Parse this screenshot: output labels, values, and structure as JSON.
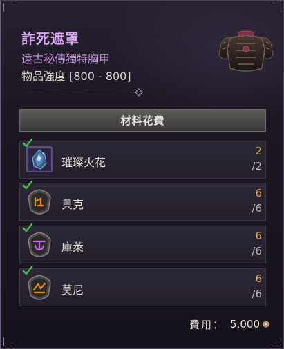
{
  "item": {
    "name": "詐死遮罩",
    "type": "遠古秘傳獨特胸甲",
    "power": "物品強度 [800 - 800]",
    "icon": "chest-armor-icon"
  },
  "materials": {
    "header": "材料花費",
    "rows": [
      {
        "name": "璀璨火花",
        "have": "2",
        "need": "/2",
        "icon": "resplendent-spark-icon",
        "checked": true
      },
      {
        "name": "貝克",
        "have": "6",
        "need": "/6",
        "icon": "ber-rune-icon",
        "checked": true
      },
      {
        "name": "庫萊",
        "have": "6",
        "need": "/6",
        "icon": "cir-rune-icon",
        "checked": true
      },
      {
        "name": "莫尼",
        "have": "6",
        "need": "/6",
        "icon": "mon-rune-icon",
        "checked": true
      }
    ]
  },
  "fee": {
    "label": "費用：",
    "value": "5,000",
    "icon": "gold-coin-icon"
  },
  "colors": {
    "title": "#d7a6f1",
    "subtitle": "#c49ae0",
    "have": "#e2a958",
    "check": "#3fbf4a",
    "rune": "#e08a20",
    "rune_purple": "#c06adf"
  }
}
